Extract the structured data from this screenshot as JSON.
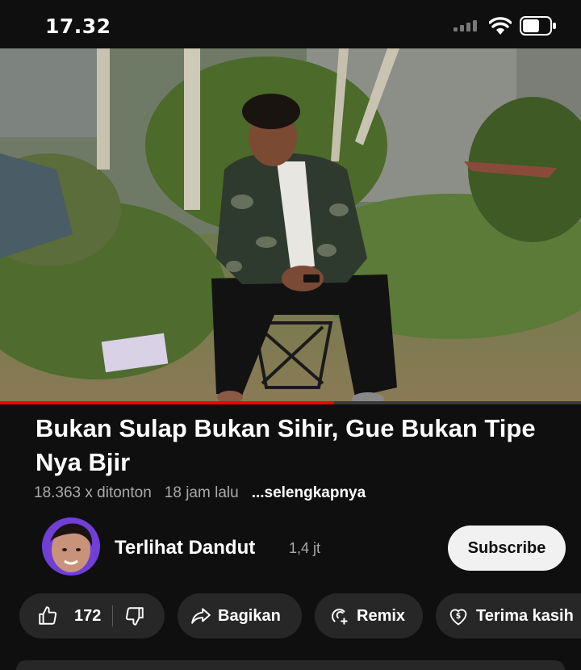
{
  "status_bar": {
    "time": "17.32"
  },
  "video": {
    "progress": 0.575
  },
  "title": "Bukan Sulap Bukan Sihir, Gue Bukan Tipe Nya Bjir",
  "meta": {
    "views": "18.363 x ditonton",
    "time_ago": "18 jam lalu",
    "more": "...selengkapnya"
  },
  "channel": {
    "name": "Terlihat Dandut",
    "subscribers": "1,4 jt",
    "subscribe_label": "Subscribe"
  },
  "actions": {
    "like_count": "172",
    "share_label": "Bagikan",
    "remix_label": "Remix",
    "thanks_label": "Terima kasih"
  },
  "colors": {
    "accent": "#ff0000",
    "background": "#0f0f0f",
    "chip": "#272727"
  }
}
